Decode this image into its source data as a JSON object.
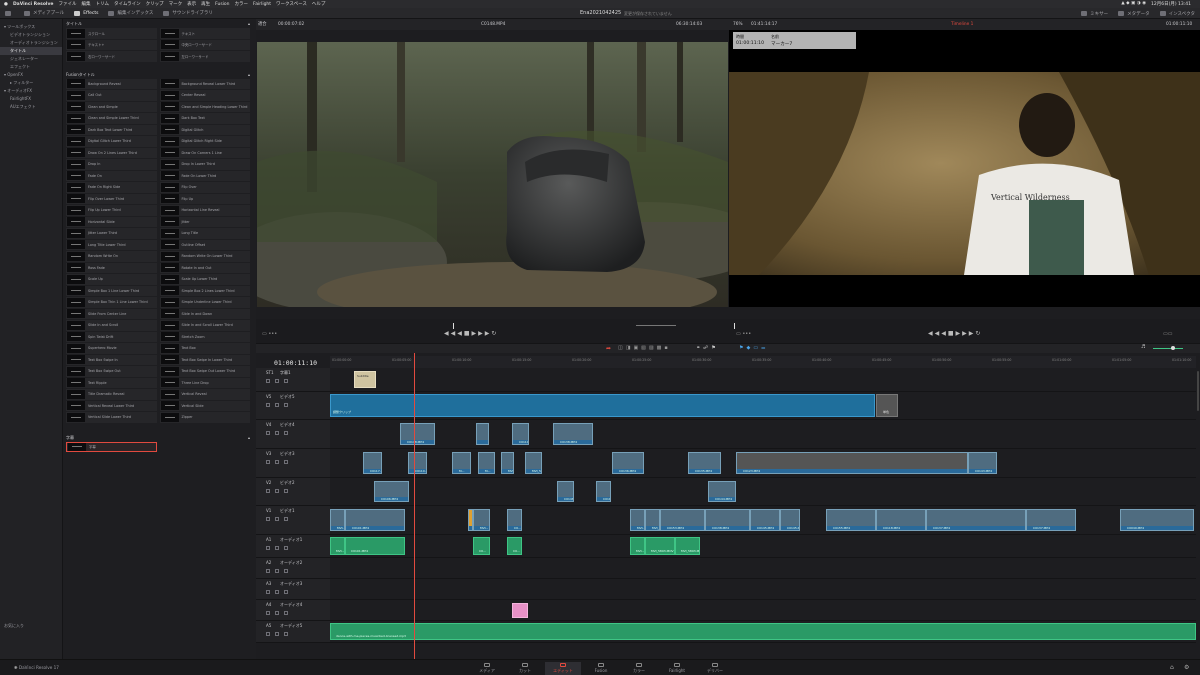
{
  "menubar": {
    "app": "DaVinci Resolve",
    "items": [
      "ファイル",
      "編集",
      "トリム",
      "タイムライン",
      "クリップ",
      "マーク",
      "表示",
      "再生",
      "Fusion",
      "カラー",
      "Fairlight",
      "ワークスペース",
      "ヘルプ"
    ],
    "clock": "12月6日(月) 13:41"
  },
  "topbar": {
    "media_pool": "メディアプール",
    "effects": "Effects",
    "edit_index": "編集インデックス",
    "sound_library": "サウンドライブラリ",
    "project_title": "Ena2021042425",
    "project_status": "変更が保存されていません",
    "mixer": "ミキサー",
    "metadata": "メタデータ",
    "inspector": "インスペクタ"
  },
  "leftnav": {
    "items": [
      {
        "label": "ツールボックス",
        "level": 0
      },
      {
        "label": "ビデオトランジション",
        "level": 1
      },
      {
        "label": "オーディオトランジション",
        "level": 1
      },
      {
        "label": "タイトル",
        "level": 1,
        "selected": true
      },
      {
        "label": "ジェネレーター",
        "level": 1
      },
      {
        "label": "エフェクト",
        "level": 1
      },
      {
        "label": "OpenFX",
        "level": 0
      },
      {
        "label": "フィルター",
        "level": 1
      },
      {
        "label": "オーディオFX",
        "level": 0
      },
      {
        "label": "FairlightFX",
        "level": 1
      },
      {
        "label": "AUエフェクト",
        "level": 1
      }
    ],
    "favorites": "お気に入り"
  },
  "library": {
    "titles_header": "タイトル",
    "titles": [
      "スクロール",
      "テキスト",
      "テキスト+",
      "中央ローワーサード",
      "右ローワーサード",
      "左ローワーサード"
    ],
    "fusion_header": "Fusionタイトル",
    "fusion_titles": [
      "Background Reveal",
      "Background Reveal Lower Third",
      "Call Out",
      "Center Reveal",
      "Clean and Simple",
      "Clean and Simple Heading Lower Third",
      "Clean and Simple Lower Third",
      "Dark Box Text",
      "Dark Box Text Lower Third",
      "Digital Glitch",
      "Digital Glitch Lower Third",
      "Digital Glitch Right Side",
      "Draw On 2 Lines Lower Third",
      "Draw On Corners 1 Line",
      "Drop In",
      "Drop In Lower Third",
      "Fade On",
      "Fade On Lower Third",
      "Fade On Right Side",
      "Flip Over",
      "Flip Over Lower Third",
      "Flip Up",
      "Flip Up Lower Third",
      "Horizontal Line Reveal",
      "Horizontal Slide",
      "Jitter",
      "Jitter Lower Third",
      "Long Title",
      "Long Title Lower Third",
      "Outline Offset",
      "Random Write On",
      "Random Write On Lower Third",
      "Ross Fade",
      "Rotate In and Out",
      "Scale Up",
      "Scale Up Lower Third",
      "Simple Box 1 Line Lower Third",
      "Simple Box 2 Lines Lower Third",
      "Simple Box Thin 1 Line Lower Third",
      "Simple Underline Lower Third",
      "Slide From Center Line",
      "Slide In and Down",
      "Slide In and Scroll",
      "Slide In and Scroll Lower Third",
      "Spin Twist Drift",
      "Stretch Zoom",
      "Superhero Movie",
      "Text Box",
      "Text Box Swipe In",
      "Text Box Swipe In Lower Third",
      "Text Box Swipe Out",
      "Text Box Swipe Out Lower Third",
      "Text Ripple",
      "Three Line Drop",
      "Title Dramatic Reveal",
      "Vertical Reveal",
      "Vertical Reveal Lower Third",
      "Vertical Slide",
      "Vertical Slide Lower Third",
      "Zipper"
    ],
    "subtitle_header": "字幕",
    "subtitle_item": "字幕"
  },
  "viewer": {
    "zoom_left": "適合",
    "src_tc": "00:00:07:02",
    "src_clip": "C0148.MP4",
    "src_duration": "06:30:14:03",
    "zoom_right": "76%",
    "rec_tc": "01:41:14:17",
    "timeline_name": "Timeline 1",
    "timeline_tc": "01:00:11:10",
    "marker_hdr_time": "時間",
    "marker_hdr_name": "名前",
    "marker_time": "01:00:11:10",
    "marker_name": "マーカー7"
  },
  "timeline": {
    "timecode": "01:00:11:10",
    "ruler": [
      "01:00:00:00",
      "01:00:05:00",
      "01:00:10:00",
      "01:00:15:00",
      "01:00:20:00",
      "01:00:25:00",
      "01:00:30:00",
      "01:00:35:00",
      "01:00:40:00",
      "01:00:45:00",
      "01:00:50:00",
      "01:00:55:00",
      "01:01:00:00",
      "01:01:05:00",
      "01:01:10:00",
      "01:01:15:00"
    ],
    "tracks": {
      "st1": {
        "id": "ST1",
        "name": "字幕1",
        "clip": "Subtitle"
      },
      "v5": {
        "id": "V5",
        "name": "ビデオ5",
        "clip": "調整クリップ",
        "gen": "単色"
      },
      "v4": {
        "id": "V4",
        "name": "ビデオ4",
        "clips": [
          "C0148.MP4",
          "C0110.MP4",
          "C0138.MP4"
        ]
      },
      "v3": {
        "id": "V3",
        "name": "ビデオ3",
        "clips": [
          "C0117...",
          "C0110...",
          "M...",
          "MVI_53...",
          "C0136.MP4",
          "C0135.MP4",
          "C0123.MP4",
          "C0143.MP4"
        ]
      },
      "v2": {
        "id": "V2",
        "name": "ビデオ2",
        "clips": [
          "C0106.MP4",
          "C0148...",
          "C0110...",
          "C0144.MP4"
        ]
      },
      "v1": {
        "id": "V1",
        "name": "ビデオ1",
        "clips": [
          "MVI...",
          "C0101.MP4",
          "MVI...",
          "C0...",
          "C0...",
          "MVI...",
          "MVI_5...",
          "C0153.MP4",
          "C0138.MP4",
          "C0145.MP4",
          "C0155.MP4",
          "C0118.MP4",
          "C0137.MP4",
          "C0049.MP4"
        ]
      },
      "a1": {
        "id": "A1",
        "name": "オーディオ1",
        "clips": [
          "MVI...",
          "C0101.MP4",
          "C0...",
          "C0...",
          "MVI...",
          "MVI_5893.MOV"
        ]
      },
      "a2": {
        "id": "A2",
        "name": "オーディオ2"
      },
      "a3": {
        "id": "A3",
        "name": "オーディオ3"
      },
      "a4": {
        "id": "A4",
        "name": "オーディオ4"
      },
      "a5": {
        "id": "A5",
        "name": "オーディオ5",
        "clip": "dance-with-me-pieces-musicbed-licensed.mp3"
      }
    }
  },
  "pages": [
    {
      "label": "メディア"
    },
    {
      "label": "カット"
    },
    {
      "label": "エディット",
      "active": true
    },
    {
      "label": "Fusion"
    },
    {
      "label": "カラー"
    },
    {
      "label": "Fairlight"
    },
    {
      "label": "デリバー"
    }
  ],
  "footer": {
    "brand": "DaVinci Resolve 17"
  },
  "colors": {
    "accent": "#e24a3f",
    "video_clip": "#4f6c80",
    "audio_clip": "#2a9a66",
    "adjustment": "#1f6f9c"
  }
}
